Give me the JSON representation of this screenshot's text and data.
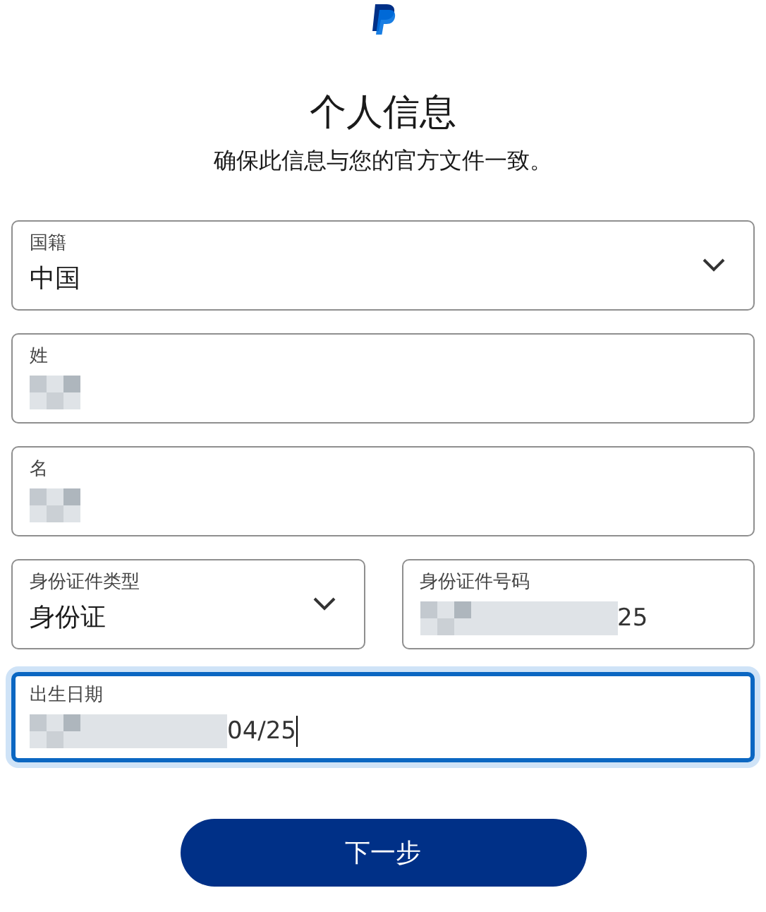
{
  "header": {
    "title": "个人信息",
    "subtitle": "确保此信息与您的官方文件一致。"
  },
  "rows": [
    {
      "fields": [
        {
          "kind": "select",
          "label": "国籍",
          "value": "中国",
          "masked": false,
          "focused": false
        }
      ]
    },
    {
      "fields": [
        {
          "kind": "text",
          "label": "姓",
          "masked": true,
          "focused": false
        }
      ]
    },
    {
      "fields": [
        {
          "kind": "text",
          "label": "名",
          "masked": true,
          "focused": false
        }
      ]
    },
    {
      "fields": [
        {
          "kind": "select",
          "label": "身份证件类型",
          "value": "身份证",
          "masked": false,
          "focused": false
        },
        {
          "kind": "text",
          "label": "身份证件号码",
          "value": "25",
          "masked": true,
          "focused": false
        }
      ]
    },
    {
      "fields": [
        {
          "kind": "text",
          "label": "出生日期",
          "value": "04/25",
          "masked": true,
          "focused": true
        }
      ]
    }
  ],
  "next_button": "下一步"
}
